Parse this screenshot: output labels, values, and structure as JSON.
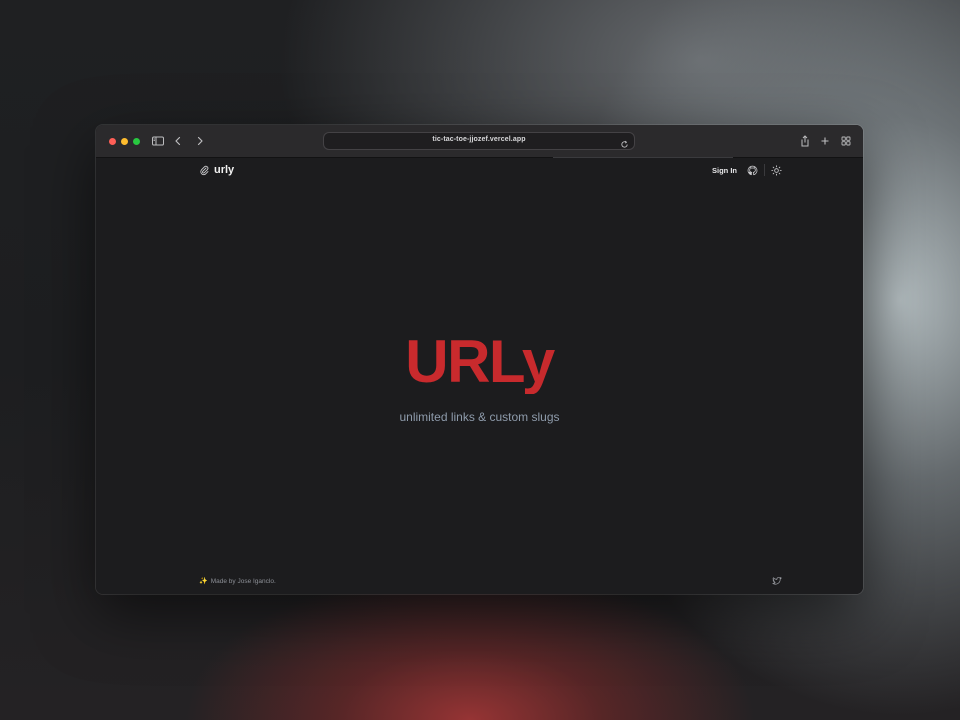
{
  "browser": {
    "url": "tic-tac-toe-jjozef.vercel.app"
  },
  "nav": {
    "brand": "urly",
    "sign_in": "Sign In"
  },
  "hero": {
    "title": "URLy",
    "subtitle": "unlimited links & custom slugs"
  },
  "footer": {
    "credit": "Made by Jose Iganclo."
  },
  "icons": {
    "brand": "paperclip-icon",
    "github": "github-icon",
    "theme": "sun-icon",
    "twitter": "twitter-icon",
    "sidebar": "sidebar-icon",
    "back": "chevron-left-icon",
    "forward": "chevron-right-icon",
    "reload": "reload-icon",
    "share": "share-icon",
    "new_tab": "plus-icon",
    "tabs": "tab-overview-icon"
  },
  "colors": {
    "accent": "#c9292c",
    "background": "#1c1c1e",
    "subtitle": "#8e9bab"
  }
}
